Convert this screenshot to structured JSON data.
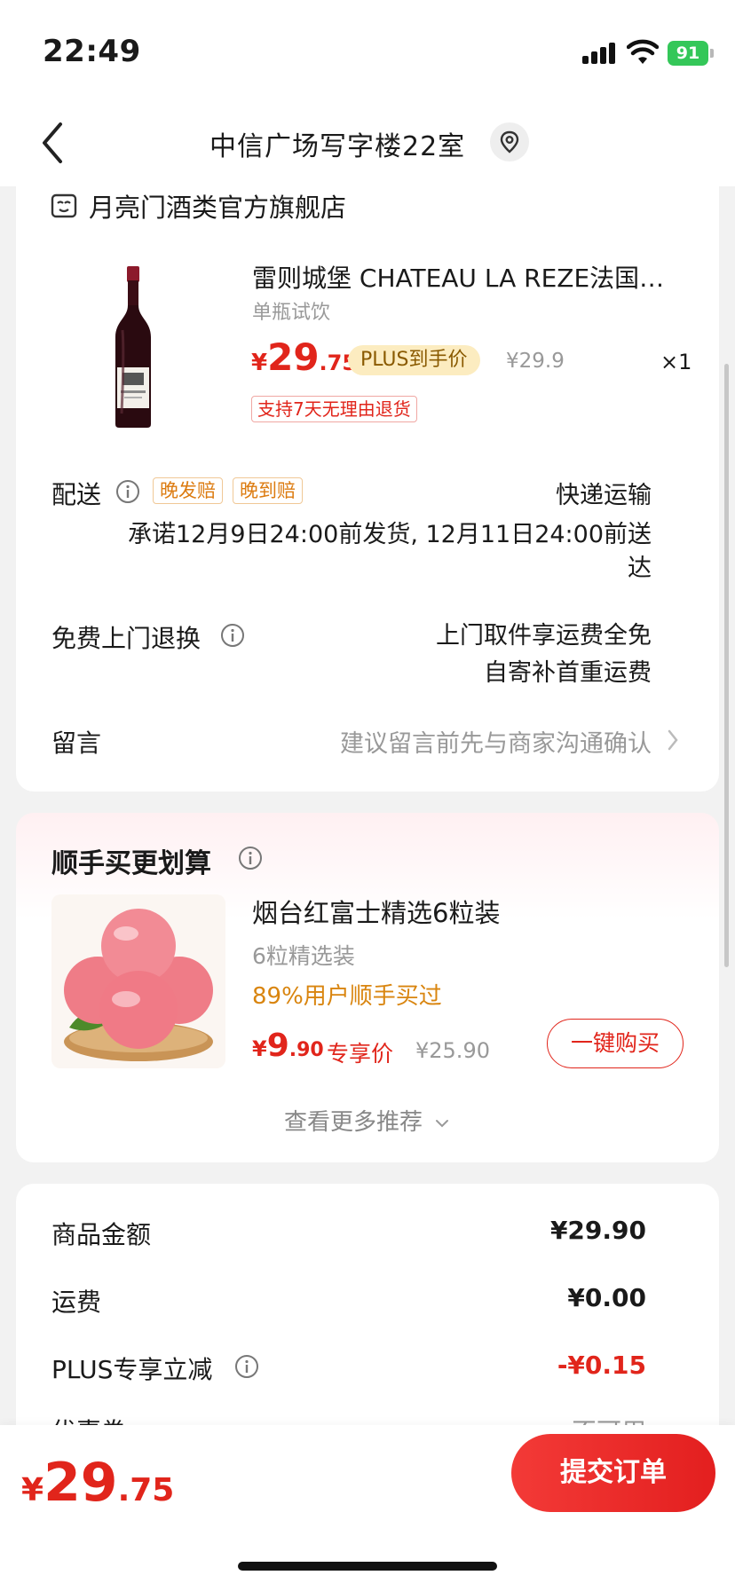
{
  "status_bar": {
    "time": "22:49",
    "battery": "91"
  },
  "nav": {
    "title": "中信广场写字楼22室"
  },
  "store": {
    "name": "月亮门酒类官方旗舰店"
  },
  "product": {
    "title": "雷则城堡 CHATEAU LA REZE法国…",
    "spec": "单瓶试饮",
    "price_currency": "¥",
    "price_int": "29",
    "price_dec": ".75",
    "plus_tag": "PLUS到手价",
    "original_price": "¥29.9",
    "quantity": "×1",
    "return_tag": "支持7天无理由退货"
  },
  "delivery": {
    "label": "配送",
    "tag_late_ship": "晚发赔",
    "tag_late_arrive": "晚到赔",
    "method": "快递运输",
    "promise_line1": "承诺12月9日24:00前发货, 12月11日24:00前送",
    "promise_line2": "达"
  },
  "free_return": {
    "label": "免费上门退换",
    "line1": "上门取件享运费全免",
    "line2": "自寄补首重运费"
  },
  "message": {
    "label": "留言",
    "placeholder": "建议留言前先与商家沟通确认"
  },
  "addon": {
    "title": "顺手买更划算",
    "name": "烟台红富士精选6粒装",
    "spec": "6粒精选装",
    "bought": "89%用户顺手买过",
    "price_currency": "¥",
    "price_int": "9",
    "price_dec": ".90",
    "exclusive_label": "专享价",
    "original_price": "¥25.90",
    "buy_button": "一键购买",
    "more_link": "查看更多推荐"
  },
  "summary": {
    "goods_label": "商品金额",
    "goods_value": "¥29.90",
    "shipping_label": "运费",
    "shipping_value": "¥0.00",
    "plus_label": "PLUS专享立减",
    "plus_value": "-¥0.15",
    "coupon_label": "优惠券",
    "coupon_value": "不可用"
  },
  "bottom": {
    "total_currency": "¥",
    "total_int": "29",
    "total_dec": ".75",
    "submit": "提交订单"
  },
  "colors": {
    "accent_red": "#e1251b",
    "plus_gold_bg": "#fcecc0",
    "orange": "#dc7b10",
    "battery_green": "#34c759"
  }
}
